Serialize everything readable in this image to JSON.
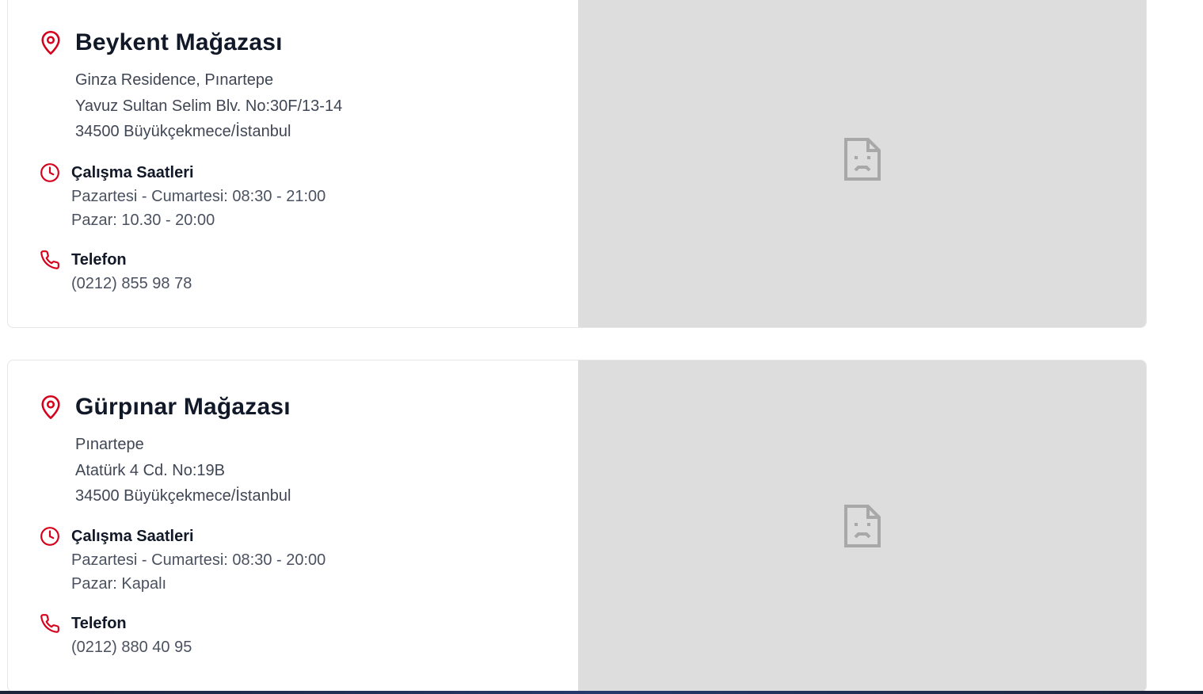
{
  "stores": [
    {
      "name": "Beykent Mağazası",
      "address": [
        "Ginza Residence, Pınartepe",
        "Yavuz Sultan Selim Blv. No:30F/13-14",
        "34500 Büyükçekmece/İstanbul"
      ],
      "hours_label": "Çalışma Saatleri",
      "hours": [
        "Pazartesi - Cumartesi: 08:30 - 21:00",
        "Pazar: 10.30 - 20:00"
      ],
      "phone_label": "Telefon",
      "phone": "(0212) 855 98 78"
    },
    {
      "name": "Gürpınar Mağazası",
      "address": [
        "Pınartepe",
        "Atatürk 4 Cd. No:19B",
        "34500 Büyükçekmece/İstanbul"
      ],
      "hours_label": "Çalışma Saatleri",
      "hours": [
        "Pazartesi - Cumartesi: 08:30 - 20:00",
        "Pazar: Kapalı"
      ],
      "phone_label": "Telefon",
      "phone": "(0212) 880 40 95"
    }
  ],
  "colors": {
    "accent": "#d6001c",
    "map_placeholder": "#dddddd",
    "broken_icon": "#a8a8a8"
  },
  "icons": {
    "location": "map-pin-icon",
    "hours": "clock-icon",
    "phone": "phone-icon",
    "map": "broken-image-icon"
  }
}
